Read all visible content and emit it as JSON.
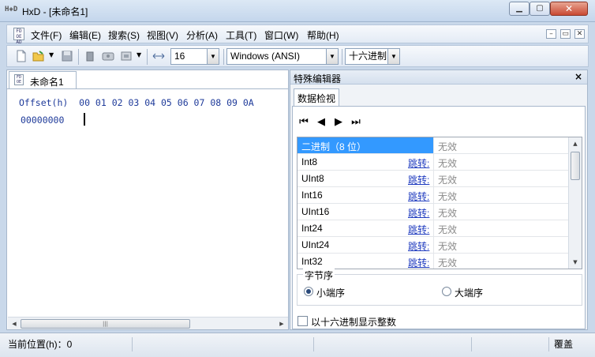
{
  "window": {
    "title": "HxD - [未命名1]",
    "min_glyph": "▁",
    "max_glyph": "▢",
    "close_glyph": "✕"
  },
  "menu": {
    "items": [
      "文件(F)",
      "编辑(E)",
      "搜索(S)",
      "视图(V)",
      "分析(A)",
      "工具(T)",
      "窗口(W)",
      "帮助(H)"
    ],
    "mdi": [
      "–",
      "▭",
      "✕"
    ]
  },
  "toolbar": {
    "icons": [
      "new-file-icon",
      "open-file-icon",
      "save-icon",
      "delete-icon",
      "disk-icon",
      "ram-icon",
      "bytes-per-row-icon"
    ],
    "bytes_per_row": "16",
    "charset": "Windows (ANSI)",
    "offset_base": "十六进制"
  },
  "editor": {
    "tab_label": "未命名1",
    "header": "Offset(h)  00 01 02 03 04 05 06 07 08 09 0A",
    "first_offset": "00000000"
  },
  "special_editor": {
    "title": "特殊编辑器",
    "close": "×",
    "tab": "数据检视",
    "nav": [
      "⏮",
      "◀",
      "▶",
      "⏭"
    ],
    "rows": [
      {
        "name": "二进制（8 位）",
        "jump": "",
        "value": "无效"
      },
      {
        "name": "Int8",
        "jump": "跳转:",
        "value": "无效"
      },
      {
        "name": "UInt8",
        "jump": "跳转:",
        "value": "无效"
      },
      {
        "name": "Int16",
        "jump": "跳转:",
        "value": "无效"
      },
      {
        "name": "UInt16",
        "jump": "跳转:",
        "value": "无效"
      },
      {
        "name": "Int24",
        "jump": "跳转:",
        "value": "无效"
      },
      {
        "name": "UInt24",
        "jump": "跳转:",
        "value": "无效"
      },
      {
        "name": "Int32",
        "jump": "跳转:",
        "value": "无效"
      }
    ],
    "byte_order": {
      "legend": "字节序",
      "little": "小端序",
      "big": "大端序",
      "selected": "little"
    },
    "hex_ints_label": "以十六进制显示整数"
  },
  "status": {
    "position": "当前位置(h)：0",
    "mode": "覆盖"
  }
}
